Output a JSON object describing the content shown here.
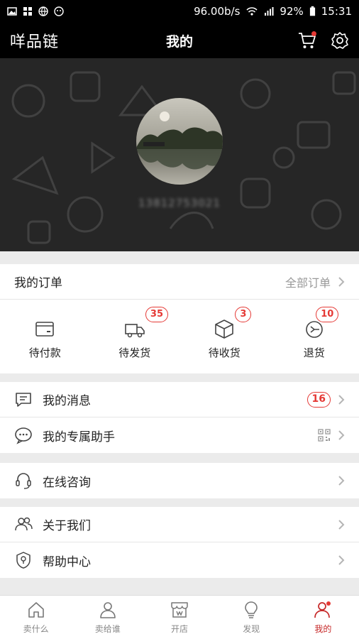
{
  "status_bar": {
    "speed": "96.00b/s",
    "battery": "92%",
    "time": "15:31"
  },
  "header": {
    "brand": "咩品链",
    "title": "我的"
  },
  "profile": {
    "phone": "13812753021"
  },
  "orders": {
    "title": "我的订单",
    "all_label": "全部订单",
    "items": [
      {
        "label": "待付款",
        "badge": ""
      },
      {
        "label": "待发货",
        "badge": "35"
      },
      {
        "label": "待收货",
        "badge": "3"
      },
      {
        "label": "退货",
        "badge": "10"
      }
    ]
  },
  "menu": {
    "messages": {
      "label": "我的消息",
      "badge": "16"
    },
    "assistant": {
      "label": "我的专属助手"
    },
    "consult": {
      "label": "在线咨询"
    },
    "about": {
      "label": "关于我们"
    },
    "help": {
      "label": "帮助中心"
    }
  },
  "tabs": [
    {
      "label": "卖什么"
    },
    {
      "label": "卖给谁"
    },
    {
      "label": "开店"
    },
    {
      "label": "发现"
    },
    {
      "label": "我的"
    }
  ],
  "colors": {
    "accent": "#c62828",
    "badge": "#e53935",
    "header_bg": "#000000",
    "profile_bg": "#262626"
  }
}
